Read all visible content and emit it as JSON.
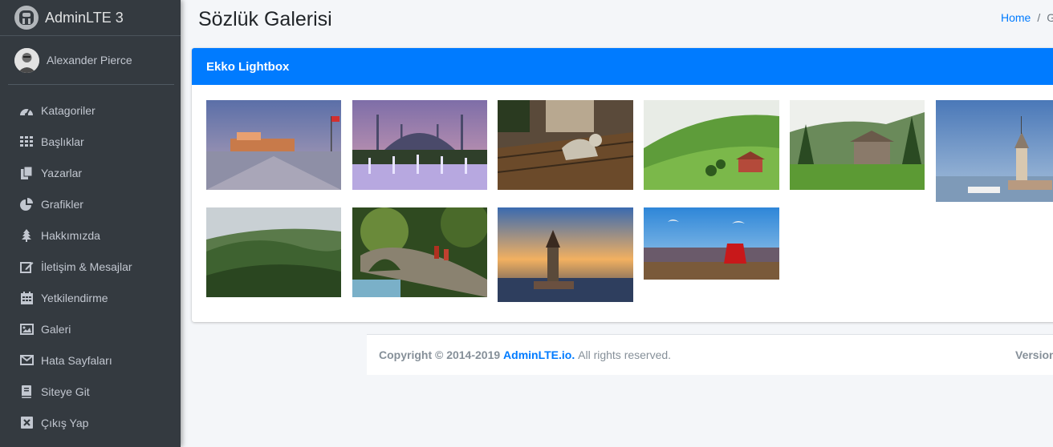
{
  "brand": {
    "title": "AdminLTE 3"
  },
  "user": {
    "name": "Alexander Pierce"
  },
  "sidebar": {
    "items": [
      {
        "label": "Katagoriler",
        "icon": "dashboard-icon"
      },
      {
        "label": "Başlıklar",
        "icon": "grid-icon"
      },
      {
        "label": "Yazarlar",
        "icon": "copy-icon"
      },
      {
        "label": "Grafikler",
        "icon": "pie-chart-icon"
      },
      {
        "label": "Hakkımızda",
        "icon": "tree-icon"
      },
      {
        "label": "İletişim & Mesajlar",
        "icon": "edit-icon"
      },
      {
        "label": "Yetkilendirme",
        "icon": "calendar-icon"
      },
      {
        "label": "Galeri",
        "icon": "image-icon"
      },
      {
        "label": "Hata Sayfaları",
        "icon": "envelope-icon"
      },
      {
        "label": "Siteye Git",
        "icon": "book-icon"
      },
      {
        "label": "Çıkış Yap",
        "icon": "close-box-icon"
      }
    ]
  },
  "header": {
    "title": "Sözlük Galerisi"
  },
  "breadcrumb": {
    "home": "Home",
    "separator": "/",
    "current": "G"
  },
  "gallery": {
    "card_title": "Ekko Lightbox",
    "images": [
      "ataturk-mausoleum",
      "blue-mosque-fountains",
      "cat-on-bench",
      "green-highland-house",
      "wooden-shed-forest",
      "maidens-tower-day",
      "misty-green-hills",
      "stone-bridge-waterfall",
      "maidens-tower-sunset",
      "istanbul-tea-seagulls"
    ]
  },
  "footer": {
    "copyright": "Copyright © 2014-2019",
    "link": "AdminLTE.io.",
    "rights": "All rights reserved.",
    "version": "Version"
  },
  "colors": {
    "primary": "#007bff",
    "sidebar": "#343a40",
    "background": "#f4f6f9"
  }
}
